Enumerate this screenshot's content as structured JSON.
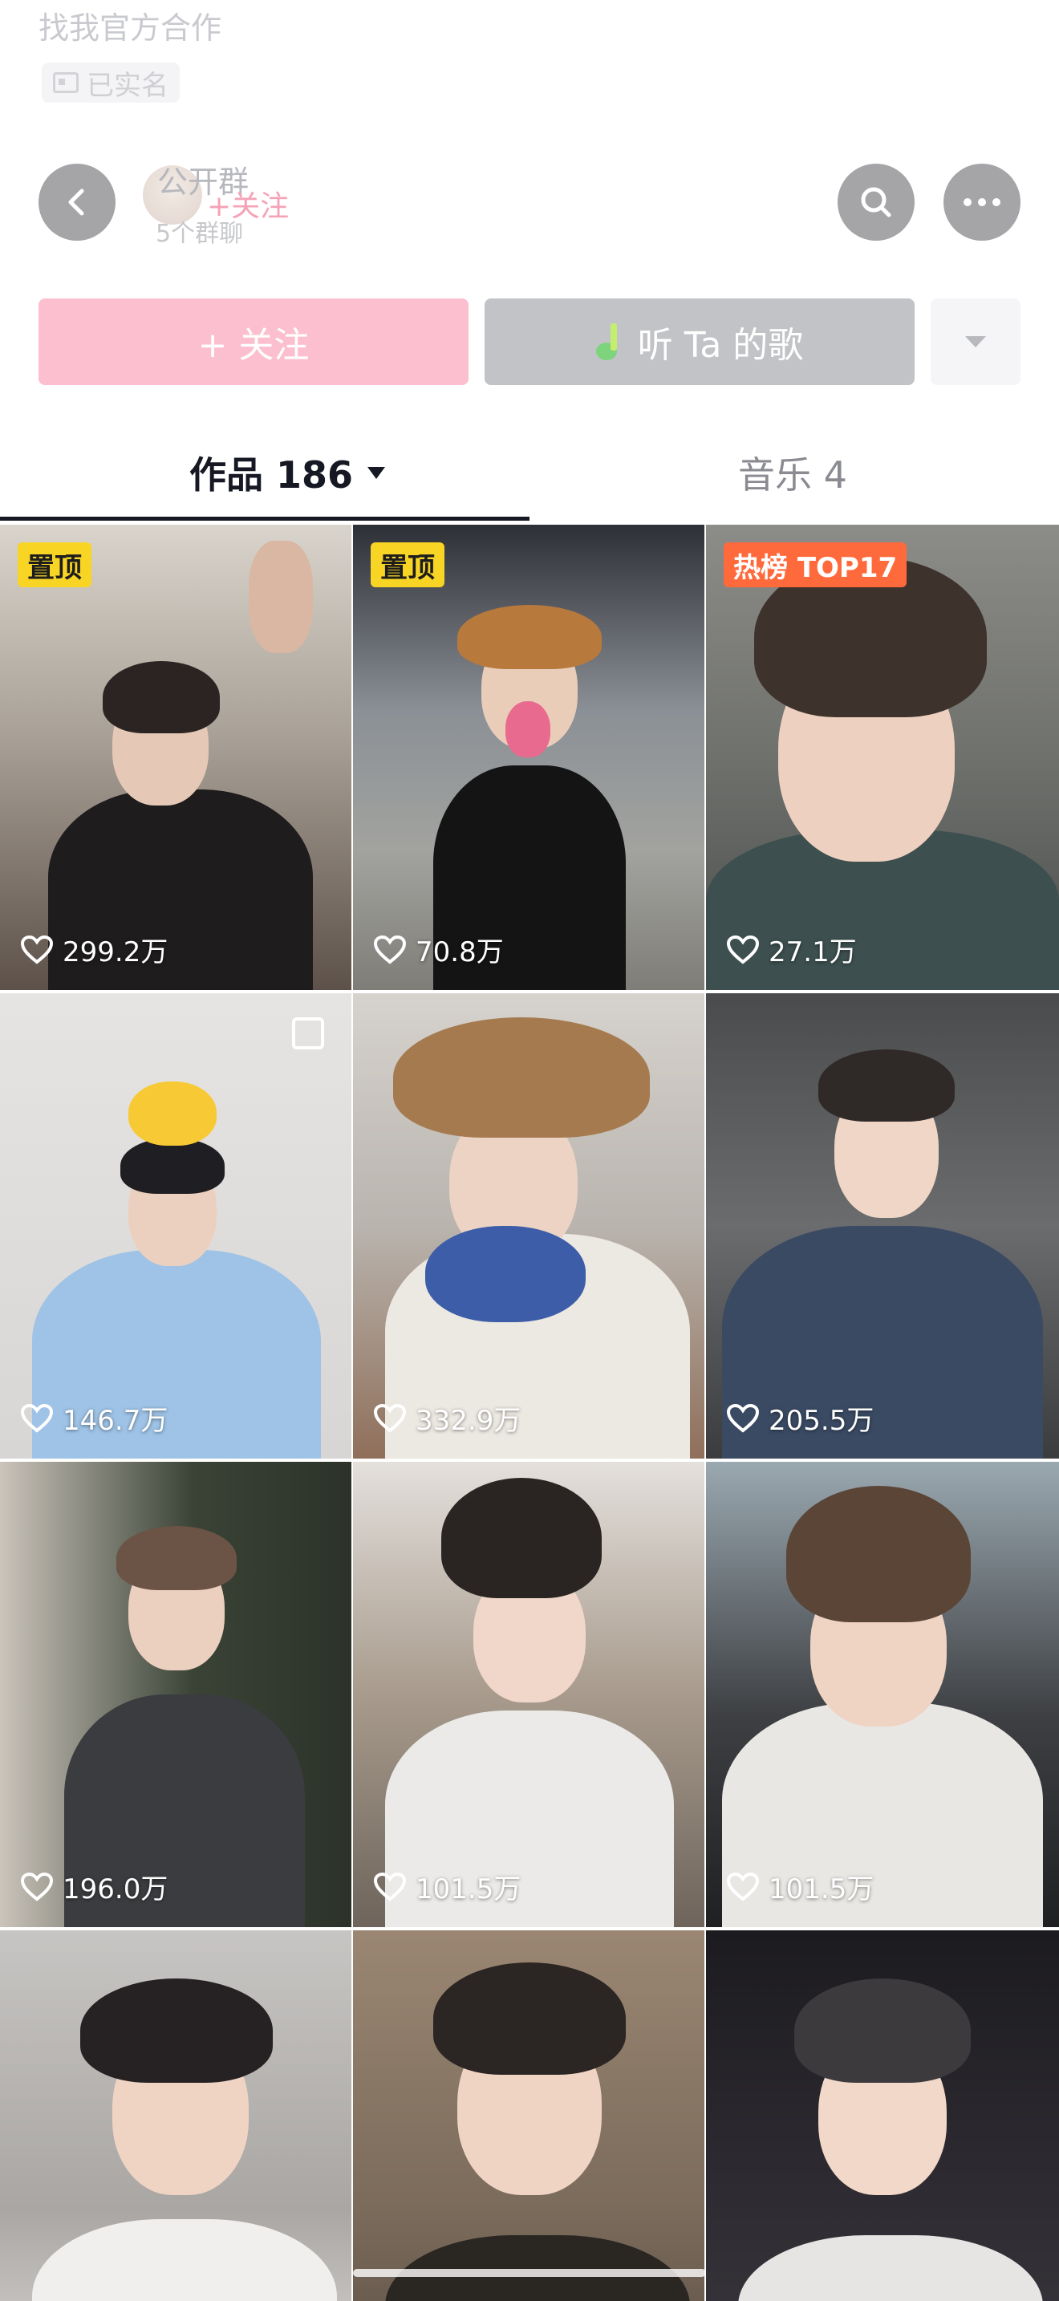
{
  "header": {
    "faded_text": "找我官方合作",
    "verified_label": "已实名",
    "group": {
      "title": "公开群",
      "subtitle": "5个群聊",
      "follow_small": "+关注"
    }
  },
  "nav": {
    "back_icon": "chevron-left-icon",
    "search_icon": "search-icon",
    "more_icon": "more-icon"
  },
  "actions": {
    "follow_label": "+ 关注",
    "song_label": "听 Ta 的歌",
    "dropdown_icon": "caret-down-icon"
  },
  "tabs": [
    {
      "label": "作品 186",
      "active": true
    },
    {
      "label": "音乐 4",
      "active": false
    }
  ],
  "videos": [
    {
      "badge": "置顶",
      "badge_type": "pin",
      "likes": "299.2万"
    },
    {
      "badge": "置顶",
      "badge_type": "pin",
      "likes": "70.8万"
    },
    {
      "badge": "热榜 TOP17",
      "badge_type": "hot",
      "likes": "27.1万"
    },
    {
      "badge": "",
      "badge_type": "",
      "likes": "146.7万",
      "multi": true
    },
    {
      "badge": "",
      "badge_type": "",
      "likes": "332.9万"
    },
    {
      "badge": "",
      "badge_type": "",
      "likes": "205.5万"
    },
    {
      "badge": "",
      "badge_type": "",
      "likes": "196.0万"
    },
    {
      "badge": "",
      "badge_type": "",
      "likes": "101.5万"
    },
    {
      "badge": "",
      "badge_type": "",
      "likes": "101.5万"
    },
    {
      "badge": "",
      "badge_type": "",
      "likes": ""
    },
    {
      "badge": "",
      "badge_type": "",
      "likes": ""
    },
    {
      "badge": "",
      "badge_type": "",
      "likes": ""
    }
  ],
  "colors": {
    "follow_bg": "#fcbfcf",
    "song_bg": "#c2c3c7",
    "pin_badge": "#f8d424",
    "hot_badge": "#ff6a3c"
  }
}
